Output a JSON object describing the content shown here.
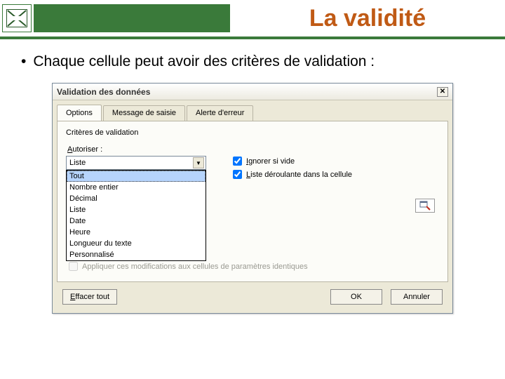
{
  "slide": {
    "title": "La validité",
    "bullet": "Chaque cellule peut avoir des critères de validation :"
  },
  "dialog": {
    "title": "Validation des données",
    "close_icon": "close-icon",
    "tabs": {
      "options": "Options",
      "input_msg": "Message de saisie",
      "error_alert": "Alerte d'erreur"
    },
    "section_label": "Critères de validation",
    "allow_label": "Autoriser :",
    "allow_value": "Liste",
    "allow_options": [
      "Tout",
      "Nombre entier",
      "Décimal",
      "Liste",
      "Date",
      "Heure",
      "Longueur du texte",
      "Personnalisé"
    ],
    "allow_selected_index": 0,
    "ignore_blank": "Ignorer si vide",
    "in_cell_dropdown": "Liste déroulante dans la cellule",
    "apply_changes": "Appliquer ces modifications aux cellules de paramètres identiques",
    "apply_enabled": false
  },
  "buttons": {
    "clear_all": "Effacer tout",
    "ok": "OK",
    "cancel": "Annuler"
  }
}
